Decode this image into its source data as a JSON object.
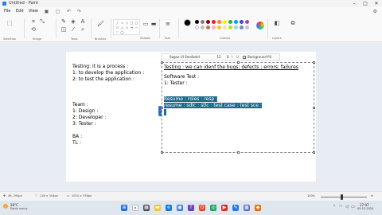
{
  "window": {
    "title": "Untitled - Paint",
    "min_icon": "minimize-icon",
    "max_icon": "maximize-icon",
    "close_icon": "close-icon"
  },
  "menu": {
    "file": "File",
    "edit": "Edit",
    "view": "View"
  },
  "ribbon": {
    "selection": "Selection",
    "image": "Image",
    "tools": "Tools",
    "brushes": "Brushes",
    "shapes": "Shapes",
    "size": "Size",
    "colours": "Colours",
    "layers": "Layers"
  },
  "palette": [
    "#000000",
    "#7f7f7f",
    "#880015",
    "#ed1c24",
    "#ff7f27",
    "#fff200",
    "#22b14c",
    "#00a2e8",
    "#3f48cc",
    "#a349a4",
    "#ffffff",
    "#c3c3c3",
    "#b97a57",
    "#ffaec9",
    "#ffc90e",
    "#efe4b0",
    "#b5e61d",
    "#99d9ea",
    "#7092be",
    "#c8bfe7"
  ],
  "font_toolbar": {
    "font": "Segoe UI Semibold",
    "size": "12",
    "background": "Background fill"
  },
  "canvas_left_text": [
    "Testing: it is a process :",
    "1: to develop the application :",
    "2: to test the application :",
    "",
    "",
    "",
    "Team :",
    "1: Design :",
    "2: Developer :",
    "3: Tester :",
    "",
    "BA :",
    "TL :"
  ],
  "textbox": {
    "line1": "Testing : we can idenf the bugs; defects ; errors; failures",
    "line2": "Software Test :",
    "line3": "1: Tester :",
    "sel1": "Resume : roles : resp :",
    "sel2": "resume : sdlc : stlc : test case : test sce :"
  },
  "status": {
    "cursor": "46, 294px",
    "selection": "116 × 104px",
    "canvas_size": "1024 × 576px",
    "zoom": "100%"
  },
  "taskbar": {
    "weather_temp": "28°C",
    "weather_desc": "Partly sunny",
    "time": "17:07",
    "date": "09-12-2024"
  }
}
